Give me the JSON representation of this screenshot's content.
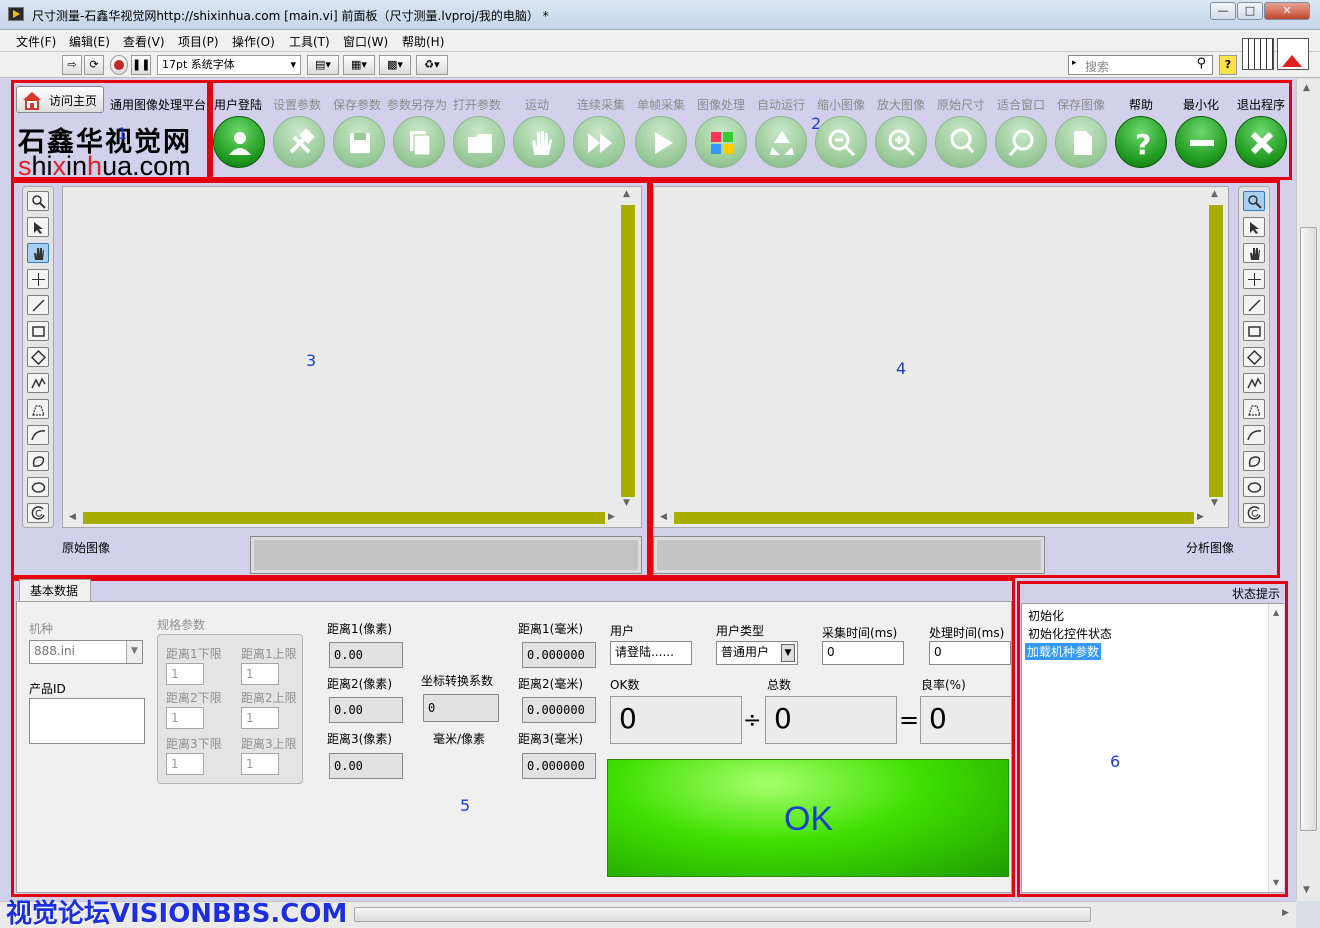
{
  "window": {
    "title": "尺寸测量-石鑫华视觉网http://shixinhua.com [main.vi] 前面板（尺寸测量.lvproj/我的电脑） *"
  },
  "menu": [
    "文件(F)",
    "编辑(E)",
    "查看(V)",
    "项目(P)",
    "操作(O)",
    "工具(T)",
    "窗口(W)",
    "帮助(H)"
  ],
  "toolbar": {
    "font_select": "17pt 系统字体",
    "search_placeholder": "搜索",
    "help_glyph": "?"
  },
  "header": {
    "home_button": "访问主页",
    "platform": "通用图像处理平台",
    "logo_cn": "石鑫华视觉网",
    "logo_url": "shixinhua.com",
    "logo_red_s": "s",
    "logo_mid_hi": "hi",
    "logo_red_x": "x",
    "logo_mid_in": "in",
    "logo_red_h": "h",
    "logo_mid_ua": "ua.com",
    "region_num": "1"
  },
  "buttons": [
    {
      "label": "用户登陆",
      "enabled": true,
      "icon": "user-icon"
    },
    {
      "label": "设置参数",
      "enabled": false,
      "icon": "tools-icon"
    },
    {
      "label": "保存参数",
      "enabled": false,
      "icon": "save-icon"
    },
    {
      "label": "参数另存为",
      "enabled": false,
      "icon": "save-as-icon"
    },
    {
      "label": "打开参数",
      "enabled": false,
      "icon": "folder-icon"
    },
    {
      "label": "运动",
      "enabled": false,
      "icon": "hand-icon"
    },
    {
      "label": "连续采集",
      "enabled": false,
      "icon": "fast-forward-icon"
    },
    {
      "label": "单帧采集",
      "enabled": false,
      "icon": "play-icon"
    },
    {
      "label": "图像处理",
      "enabled": false,
      "icon": "windows-icon"
    },
    {
      "label": "自动运行",
      "enabled": false,
      "icon": "recycle-icon"
    },
    {
      "label": "缩小图像",
      "enabled": false,
      "icon": "zoom-out-icon"
    },
    {
      "label": "放大图像",
      "enabled": false,
      "icon": "zoom-in-icon"
    },
    {
      "label": "原始尺寸",
      "enabled": false,
      "icon": "zoom-one-to-one-icon"
    },
    {
      "label": "适合窗口",
      "enabled": false,
      "icon": "zoom-fit-icon"
    },
    {
      "label": "保存图像",
      "enabled": false,
      "icon": "document-icon"
    },
    {
      "label": "帮助",
      "enabled": true,
      "icon": "help-icon"
    },
    {
      "label": "最小化",
      "enabled": true,
      "icon": "minimize-icon"
    },
    {
      "label": "退出程序",
      "enabled": true,
      "icon": "close-icon"
    }
  ],
  "buttons_region_num": "2",
  "original_image": {
    "label": "原始图像",
    "region_num": "3"
  },
  "analysis_image": {
    "label": "分析图像",
    "region_num": "4"
  },
  "basic": {
    "tab": "基本数据",
    "region_num": "5",
    "model_label": "机种",
    "model_value": "888.ini",
    "product_id_label": "产品ID",
    "spec_label": "规格参数",
    "limits": [
      {
        "lower_label": "距离1下限",
        "upper_label": "距离1上限",
        "lower": "1",
        "upper": "1"
      },
      {
        "lower_label": "距离2下限",
        "upper_label": "距离2上限",
        "lower": "1",
        "upper": "1"
      },
      {
        "lower_label": "距离3下限",
        "upper_label": "距离3上限",
        "lower": "1",
        "upper": "1"
      }
    ],
    "pixel_dist": [
      {
        "label": "距离1(像素)",
        "value": "0.00"
      },
      {
        "label": "距离2(像素)",
        "value": "0.00"
      },
      {
        "label": "距离3(像素)",
        "value": "0.00"
      }
    ],
    "coef_label": "坐标转换系数",
    "coef_value": "0",
    "coef_unit": "毫米/像素",
    "mm_dist": [
      {
        "label": "距离1(毫米)",
        "value": "0.000000"
      },
      {
        "label": "距离2(毫米)",
        "value": "0.000000"
      },
      {
        "label": "距离3(毫米)",
        "value": "0.000000"
      }
    ],
    "user_label": "用户",
    "user_value": "请登陆......",
    "user_type_label": "用户类型",
    "user_type_value": "普通用户",
    "acq_time_label": "采集时间(ms)",
    "acq_time_value": "0",
    "proc_time_label": "处理时间(ms)",
    "proc_time_value": "0",
    "ok_count_label": "OK数",
    "ok_count_value": "0",
    "div_sign": "÷",
    "total_label": "总数",
    "total_value": "0",
    "eq_sign": "=",
    "yield_label": "良率(%)",
    "yield_value": "0",
    "ok_indicator": "OK"
  },
  "status": {
    "title": "状态提示",
    "region_num": "6",
    "items": [
      "初始化",
      "初始化控件状态",
      "加载机种参数"
    ]
  },
  "watermark": "视觉论坛VISIONBBS.COM",
  "colors": {
    "enabled_button": "#1f9b1f",
    "ok_green": "#3ee000",
    "highlight_red": "#e5000f",
    "scroll_olive": "#a8ae00",
    "panel_bg": "#d3d0ec"
  }
}
